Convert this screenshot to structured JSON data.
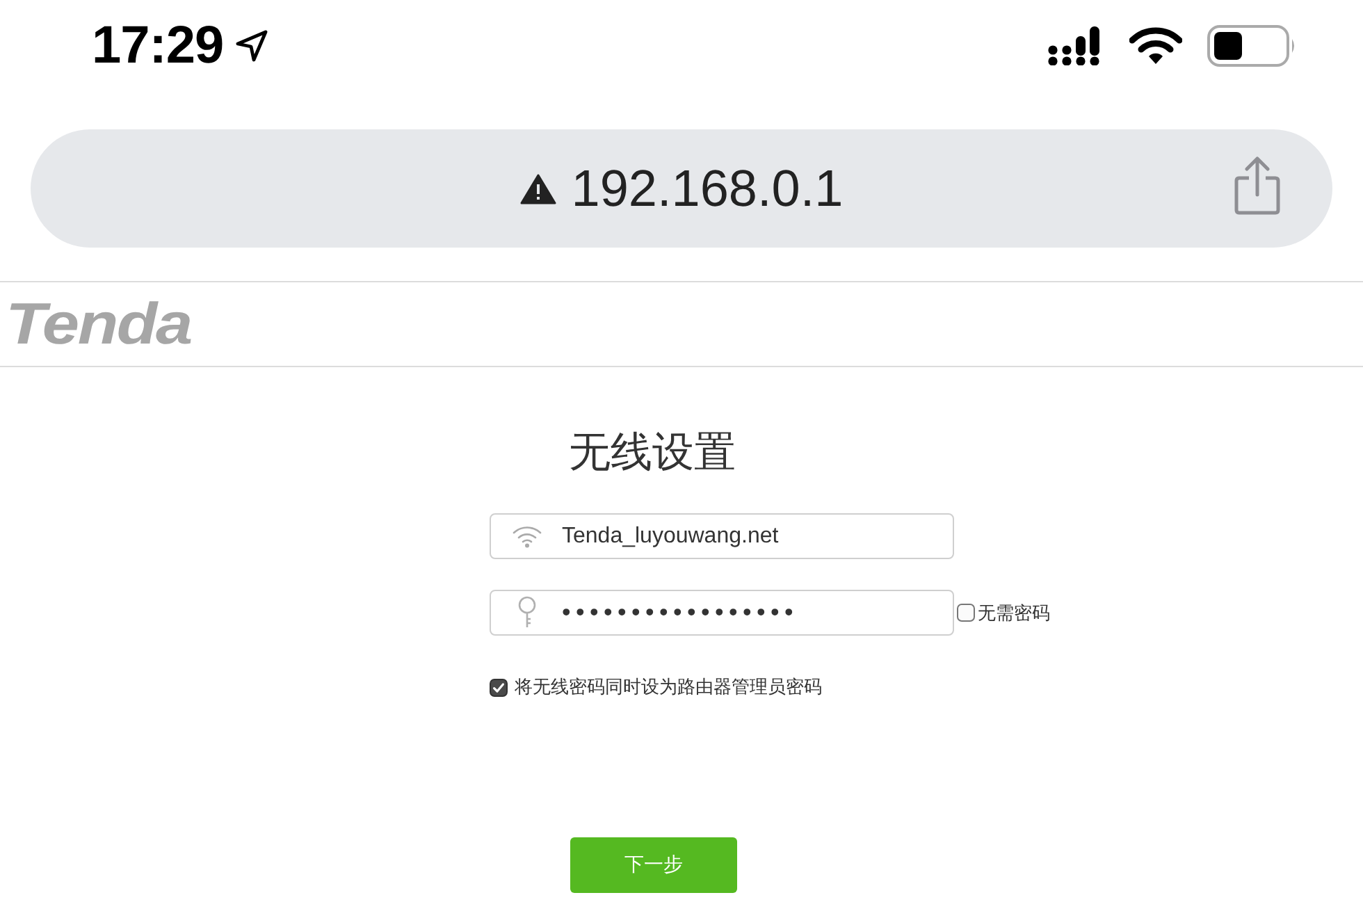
{
  "status_bar": {
    "time": "17:29"
  },
  "address_bar": {
    "url": "192.168.0.1"
  },
  "header": {
    "logo": "Tenda"
  },
  "form": {
    "title": "无线设置",
    "ssid": {
      "value": "Tenda_luyouwang.net"
    },
    "password": {
      "value": "•••••••••••••••••"
    },
    "no_password": {
      "label": "无需密码",
      "checked": false
    },
    "sync_admin_password": {
      "label": "将无线密码同时设为路由器管理员密码",
      "checked": true
    },
    "next_button": "下一步"
  }
}
